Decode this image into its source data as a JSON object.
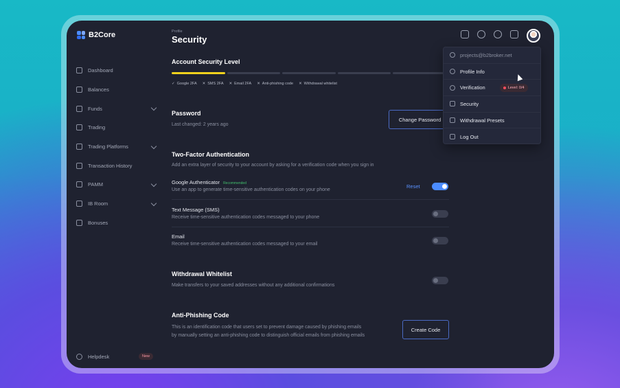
{
  "brand": {
    "name": "B2Core"
  },
  "sidebar": {
    "items": [
      {
        "label": "Dashboard",
        "expandable": false
      },
      {
        "label": "Balances",
        "expandable": false
      },
      {
        "label": "Funds",
        "expandable": true
      },
      {
        "label": "Trading",
        "expandable": false
      },
      {
        "label": "Trading Platforms",
        "expandable": true
      },
      {
        "label": "Transaction History",
        "expandable": false
      },
      {
        "label": "PAMM",
        "expandable": true
      },
      {
        "label": "IB Room",
        "expandable": true
      },
      {
        "label": "Bonuses",
        "expandable": false
      }
    ],
    "helpdesk": {
      "label": "Helpdesk",
      "badge": "New"
    }
  },
  "header": {
    "breadcrumb": "Profile",
    "title": "Security"
  },
  "security_level": {
    "title": "Account Security Level",
    "level_fraction": 0.2,
    "accent_color": "#f1d21d",
    "checks": [
      {
        "label": "Google 2FA",
        "done": true
      },
      {
        "label": "SMS 2FA",
        "done": false
      },
      {
        "label": "Email 2FA",
        "done": false
      },
      {
        "label": "Anti-phishing code",
        "done": false
      },
      {
        "label": "Withdrawal whitelist",
        "done": false
      }
    ]
  },
  "password": {
    "title": "Password",
    "last_changed": "Last changed: 2 years ago",
    "button": "Change Password"
  },
  "two_factor": {
    "title": "Two-Factor Authentication",
    "description": "Add an extra layer of security to your account by asking for a verification code when you sign in",
    "google": {
      "label": "Google Authenticator",
      "badge": "Recommended",
      "description": "Use an app to generate time-sensitive authentication codes on your phone",
      "reset": "Reset",
      "enabled": true
    },
    "sms": {
      "label": "Text Message (SMS)",
      "description": "Receive time-sensitive authentication codes messaged to your phone",
      "enabled": false
    },
    "email": {
      "label": "Email",
      "description": "Receive time-sensitive authentication codes messaged to your email",
      "enabled": false
    }
  },
  "whitelist": {
    "title": "Withdrawal Whitelist",
    "description": "Make transfers to your saved addresses without any additional confirmations",
    "enabled": false
  },
  "anti_phishing": {
    "title": "Anti-Phishing Code",
    "description": "This is an identification code that users set to prevent damage caused by phishing emails by manually setting an anti-phishing code to distinguish official emails from phishing emails",
    "button": "Create Code"
  },
  "profile_menu": {
    "email": "projects@b2broker.net",
    "items": [
      {
        "label": "Profile Info",
        "icon": "info-icon"
      },
      {
        "label": "Verification",
        "icon": "shield-icon",
        "badge": "Level: 0/4"
      },
      {
        "label": "Security",
        "icon": "lock-icon"
      },
      {
        "label": "Withdrawal Presets",
        "icon": "checklist-icon"
      },
      {
        "label": "Log Out",
        "icon": "logout-icon"
      }
    ]
  }
}
